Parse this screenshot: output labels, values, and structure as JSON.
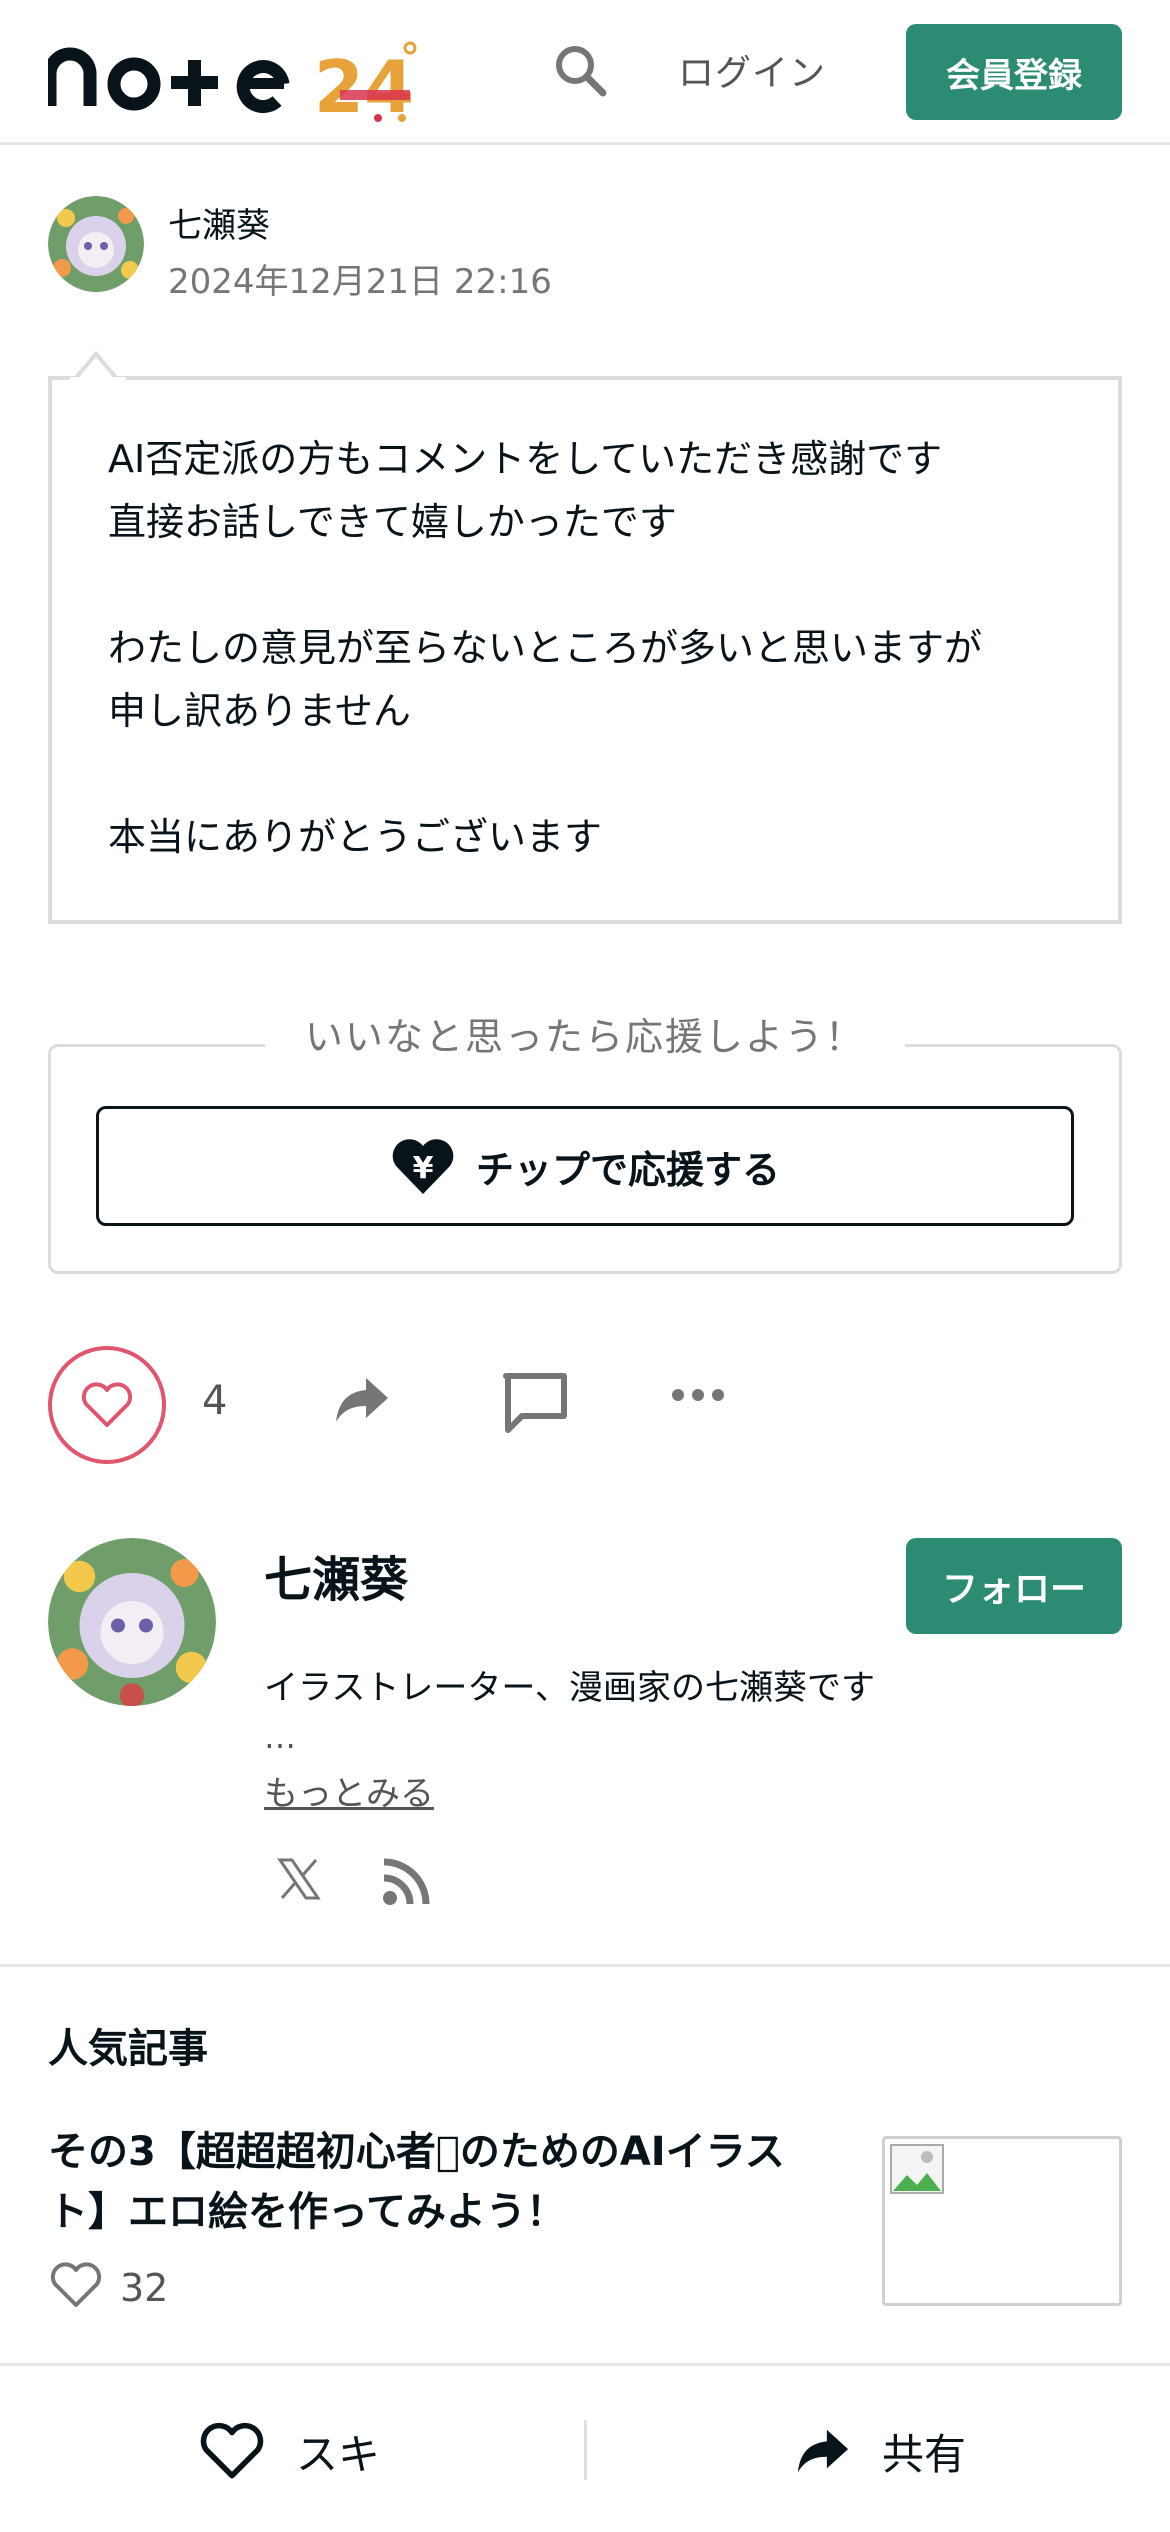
{
  "header": {
    "logo_text": "note",
    "logo_badge": "24",
    "login_label": "ログイン",
    "signup_label": "会員登録"
  },
  "comment": {
    "author": "七瀬葵",
    "date": "2024年12月21日 22:16",
    "body": "AI否定派の方もコメントをしていただき感謝です\n直接お話しできて嬉しかったです\n\nわたしの意見が至らないところが多いと思いますが\n申し訳ありません\n\n本当にありがとうございます"
  },
  "tip": {
    "heading": "いいなと思ったら応援しよう！",
    "button_label": "チップで応援する"
  },
  "actions": {
    "like_count": "4"
  },
  "profile": {
    "name": "七瀬葵",
    "follow_label": "フォロー",
    "bio": "イラストレーター、漫画家の七瀬葵です",
    "ellipsis": "…",
    "more_label": "もっとみる"
  },
  "popular": {
    "heading": "人気記事",
    "items": [
      {
        "title": "その3【超超超初心者􏿾のためのAIイラスト】エロ絵を作ってみよう！",
        "likes": "32"
      }
    ]
  },
  "bottom_bar": {
    "like_label": "スキ",
    "share_label": "共有"
  },
  "colors": {
    "brand_green": "#2c8c73",
    "like_pink": "#e0566e",
    "text_dark": "#08131a",
    "text_gray": "#767676"
  }
}
